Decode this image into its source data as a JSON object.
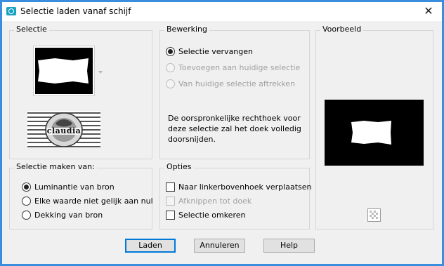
{
  "window": {
    "title": "Selectie laden vanaf schijf",
    "close_glyph": "✕"
  },
  "selectie": {
    "label": "Selectie",
    "logo_text": "claudia"
  },
  "bewerking": {
    "label": "Bewerking",
    "options": [
      {
        "label": "Selectie vervangen",
        "checked": true,
        "enabled": true
      },
      {
        "label": "Toevoegen aan huidige selectie",
        "checked": false,
        "enabled": false
      },
      {
        "label": "Van huidige selectie aftrekken",
        "checked": false,
        "enabled": false
      }
    ],
    "description_lines": [
      "De oorspronkelijke rechthoek voor",
      "deze selectie zal het doek volledig",
      "doorsnijden."
    ]
  },
  "voorbeeld": {
    "label": "Voorbeeld",
    "toggle_icon": "checkerboard-icon"
  },
  "maken_van": {
    "label": "Selectie maken van:",
    "options": [
      {
        "label": "Luminantie van bron",
        "checked": true
      },
      {
        "label": "Elke waarde niet gelijk aan nul",
        "checked": false
      },
      {
        "label": "Dekking van bron",
        "checked": false
      }
    ]
  },
  "opties": {
    "label": "Opties",
    "options": [
      {
        "label": "Naar linkerbovenhoek verplaatsen",
        "checked": false,
        "enabled": true
      },
      {
        "label": "Afknippen tot doek",
        "checked": false,
        "enabled": false
      },
      {
        "label": "Selectie omkeren",
        "checked": false,
        "enabled": true
      }
    ]
  },
  "buttons": {
    "ok": "Laden",
    "cancel": "Annuleren",
    "help": "Help"
  },
  "colors": {
    "frame": "#3a8ee0",
    "icon_accent": "#17a3c4",
    "default_button_border": "#0078d7"
  }
}
